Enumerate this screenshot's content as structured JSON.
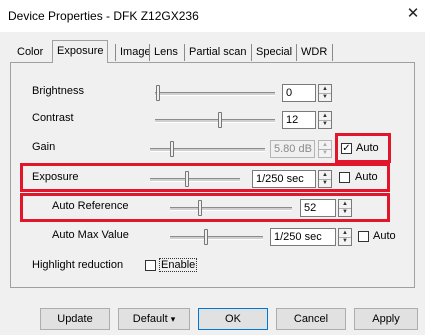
{
  "window": {
    "title": "Device Properties - DFK Z12GX236",
    "close_icon": "✕"
  },
  "tabs": [
    {
      "label": "Color",
      "active": false
    },
    {
      "label": "Exposure",
      "active": true
    },
    {
      "label": "Image",
      "active": false
    },
    {
      "label": "Lens",
      "active": false
    },
    {
      "label": "Partial scan",
      "active": false
    },
    {
      "label": "Special",
      "active": false
    },
    {
      "label": "WDR",
      "active": false
    }
  ],
  "settings": {
    "brightness": {
      "label": "Brightness",
      "value": "0"
    },
    "contrast": {
      "label": "Contrast",
      "value": "12"
    },
    "gain": {
      "label": "Gain",
      "value": "5.80 dB",
      "auto_label": "Auto",
      "auto_checked": true,
      "check_mark": "✓"
    },
    "exposure": {
      "label": "Exposure",
      "value": "1/250 sec",
      "auto_label": "Auto",
      "auto_checked": false
    },
    "auto_reference": {
      "label": "Auto Reference",
      "value": "52"
    },
    "auto_max_value": {
      "label": "Auto Max Value",
      "value": "1/250 sec",
      "auto_label": "Auto",
      "auto_checked": false
    },
    "highlight_reduction": {
      "label": "Highlight reduction",
      "enable_label": "Enable",
      "checked": false
    }
  },
  "buttons": {
    "update": "Update",
    "default": "Default",
    "default_arrow": "▾",
    "ok": "OK",
    "cancel": "Cancel",
    "apply": "Apply"
  },
  "colors": {
    "highlight": "#e2162b",
    "dialog_bg": "#f0f0f0"
  }
}
